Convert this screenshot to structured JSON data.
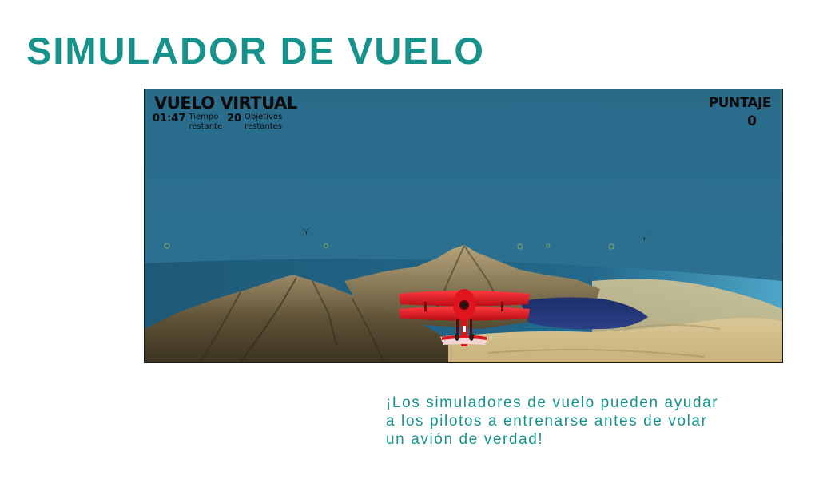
{
  "page": {
    "title": "SIMULADOR DE VUELO",
    "caption_lines": [
      "¡Los simuladores de vuelo pueden ayudar",
      "a los pilotos a entrenarse antes de volar",
      "un avión de verdad!"
    ]
  },
  "game": {
    "title": "VUELO VIRTUAL",
    "time": {
      "value": "01:47",
      "label_line1": "Tiempo",
      "label_line2": "restante"
    },
    "targets": {
      "value": "20",
      "label_line1": "Objetivos",
      "label_line2": "restantes"
    },
    "score": {
      "label": "PUNTAJE",
      "value": "0"
    }
  },
  "icons": {
    "airplane": "red-biplane",
    "birds": "bird-silhouette",
    "targets": "ring-target"
  },
  "colors": {
    "accent": "#16928b",
    "sky": "#2b6d8b",
    "sea": "#1f5f7d",
    "plane": "#e0141d"
  }
}
